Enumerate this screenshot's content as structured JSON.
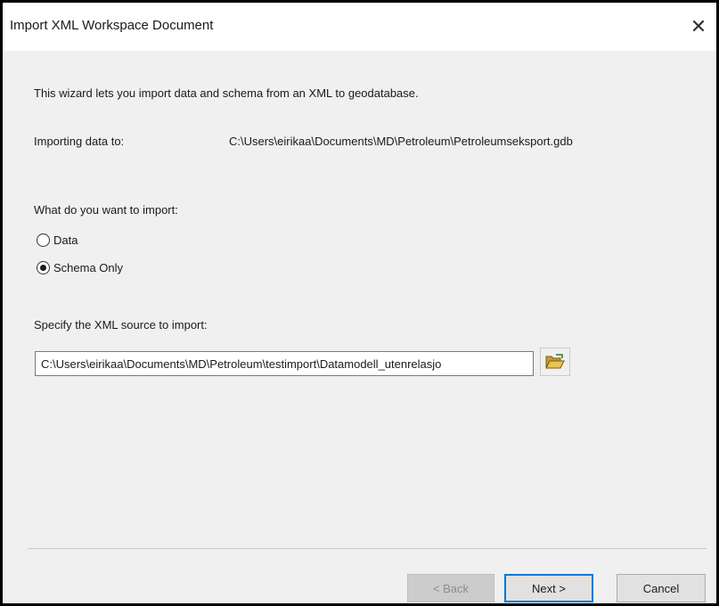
{
  "dialog": {
    "title": "Import XML Workspace Document",
    "close_symbol": "✕"
  },
  "intro": {
    "description": "This wizard lets you import data and schema from an XML to geodatabase."
  },
  "target": {
    "label": "Importing data to:",
    "path": "C:\\Users\\eirikaa\\Documents\\MD\\Petroleum\\Petroleumseksport.gdb"
  },
  "import_type": {
    "question": "What do you want to import:",
    "options": [
      {
        "label": "Data",
        "selected": false
      },
      {
        "label": "Schema Only",
        "selected": true
      }
    ]
  },
  "source": {
    "label": "Specify the XML source to import:",
    "value": "C:\\Users\\eirikaa\\Documents\\MD\\Petroleum\\testimport\\Datamodell_utenrelasjo",
    "browse_icon": "folder-open-icon"
  },
  "buttons": {
    "back": "< Back",
    "next": "Next >",
    "cancel": "Cancel"
  },
  "colors": {
    "accent": "#0078d7",
    "dialog_bg": "#f0f0f0",
    "folder": "#e8c25a"
  }
}
